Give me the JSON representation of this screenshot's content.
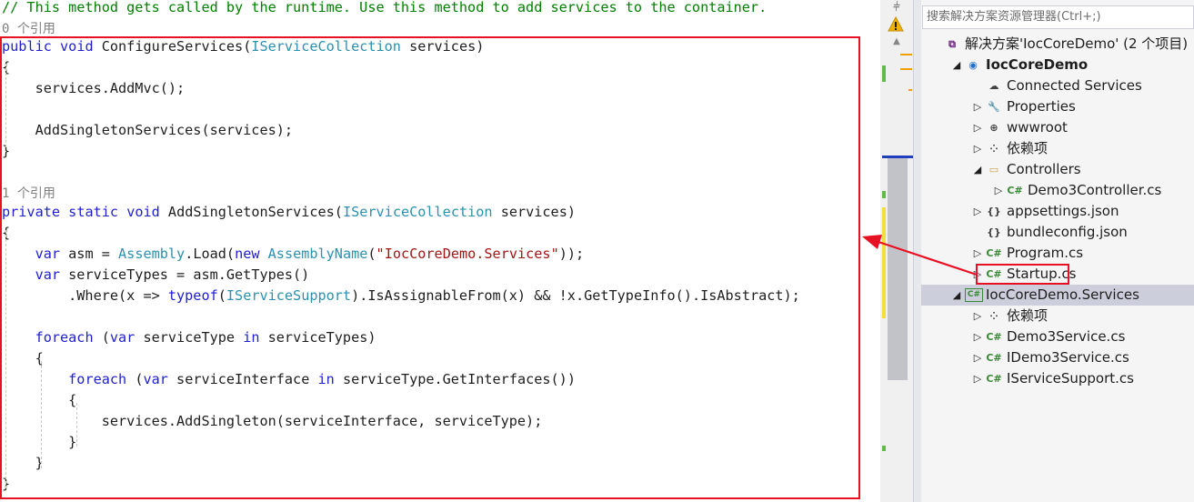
{
  "editor": {
    "lines": [
      [
        {
          "t": "cmt",
          "s": "// This method gets called by the runtime. Use this method to add services to the container."
        }
      ],
      [
        {
          "t": "ref",
          "s": "0 个引用"
        }
      ],
      [
        {
          "t": "kw",
          "s": "public"
        },
        {
          "t": "plain",
          "s": " "
        },
        {
          "t": "kw",
          "s": "void"
        },
        {
          "t": "plain",
          "s": " ConfigureServices("
        },
        {
          "t": "type",
          "s": "IServiceCollection"
        },
        {
          "t": "plain",
          "s": " services)"
        }
      ],
      [
        {
          "t": "plain",
          "s": "{"
        }
      ],
      [
        {
          "t": "plain",
          "s": "    services.AddMvc();"
        }
      ],
      [
        {
          "t": "plain",
          "s": ""
        }
      ],
      [
        {
          "t": "plain",
          "s": "    AddSingletonServices(services);"
        }
      ],
      [
        {
          "t": "plain",
          "s": "}"
        }
      ],
      [
        {
          "t": "plain",
          "s": ""
        }
      ],
      [
        {
          "t": "ref",
          "s": "1 个引用"
        }
      ],
      [
        {
          "t": "kw",
          "s": "private"
        },
        {
          "t": "plain",
          "s": " "
        },
        {
          "t": "kw",
          "s": "static"
        },
        {
          "t": "plain",
          "s": " "
        },
        {
          "t": "kw",
          "s": "void"
        },
        {
          "t": "plain",
          "s": " AddSingletonServices("
        },
        {
          "t": "type",
          "s": "IServiceCollection"
        },
        {
          "t": "plain",
          "s": " services)"
        }
      ],
      [
        {
          "t": "plain",
          "s": "{"
        }
      ],
      [
        {
          "t": "plain",
          "s": "    "
        },
        {
          "t": "kw",
          "s": "var"
        },
        {
          "t": "plain",
          "s": " asm = "
        },
        {
          "t": "type",
          "s": "Assembly"
        },
        {
          "t": "plain",
          "s": ".Load("
        },
        {
          "t": "kw",
          "s": "new"
        },
        {
          "t": "plain",
          "s": " "
        },
        {
          "t": "type",
          "s": "AssemblyName"
        },
        {
          "t": "plain",
          "s": "("
        },
        {
          "t": "str",
          "s": "\"IocCoreDemo.Services\""
        },
        {
          "t": "plain",
          "s": "));"
        }
      ],
      [
        {
          "t": "plain",
          "s": "    "
        },
        {
          "t": "kw",
          "s": "var"
        },
        {
          "t": "plain",
          "s": " serviceTypes = asm.GetTypes()"
        }
      ],
      [
        {
          "t": "plain",
          "s": "        .Where(x => "
        },
        {
          "t": "kw",
          "s": "typeof"
        },
        {
          "t": "plain",
          "s": "("
        },
        {
          "t": "type",
          "s": "IServiceSupport"
        },
        {
          "t": "plain",
          "s": ").IsAssignableFrom(x) && !x.GetTypeInfo().IsAbstract);"
        }
      ],
      [
        {
          "t": "plain",
          "s": ""
        }
      ],
      [
        {
          "t": "plain",
          "s": "    "
        },
        {
          "t": "kw",
          "s": "foreach"
        },
        {
          "t": "plain",
          "s": " ("
        },
        {
          "t": "kw",
          "s": "var"
        },
        {
          "t": "plain",
          "s": " serviceType "
        },
        {
          "t": "kw",
          "s": "in"
        },
        {
          "t": "plain",
          "s": " serviceTypes)"
        }
      ],
      [
        {
          "t": "plain",
          "s": "    {"
        }
      ],
      [
        {
          "t": "plain",
          "s": "        "
        },
        {
          "t": "kw",
          "s": "foreach"
        },
        {
          "t": "plain",
          "s": " ("
        },
        {
          "t": "kw",
          "s": "var"
        },
        {
          "t": "plain",
          "s": " serviceInterface "
        },
        {
          "t": "kw",
          "s": "in"
        },
        {
          "t": "plain",
          "s": " serviceType.GetInterfaces())"
        }
      ],
      [
        {
          "t": "plain",
          "s": "        {"
        }
      ],
      [
        {
          "t": "plain",
          "s": "            services.AddSingleton(serviceInterface, serviceType);"
        }
      ],
      [
        {
          "t": "plain",
          "s": "        }"
        }
      ],
      [
        {
          "t": "plain",
          "s": "    }"
        }
      ],
      [
        {
          "t": "plain",
          "s": "}"
        }
      ]
    ]
  },
  "colors": {
    "keyword": "#1f1fcf",
    "type": "#2b91af",
    "string": "#a31515",
    "comment": "#008000",
    "highlight": "#e81123",
    "cs_icon": "#388a34",
    "selected_row": "#cccedb"
  },
  "scrollbar": {
    "split_icon": "split-icon",
    "warning_icon": "warning-icon"
  },
  "solution_explorer": {
    "search_placeholder": "搜索解决方案资源管理器(Ctrl+;)",
    "items": [
      {
        "label": "解决方案'IocCoreDemo' (2 个项目)",
        "icon": "solution-icon",
        "expander": "",
        "bold": false,
        "selected": false
      },
      {
        "label": "IocCoreDemo",
        "icon": "web-project-icon",
        "expander": "expanded",
        "bold": true,
        "selected": false
      },
      {
        "label": "Connected Services",
        "icon": "cloud-icon",
        "expander": "",
        "bold": false,
        "selected": false
      },
      {
        "label": "Properties",
        "icon": "wrench-icon",
        "expander": "collapsed",
        "bold": false,
        "selected": false
      },
      {
        "label": "wwwroot",
        "icon": "globe-icon",
        "expander": "collapsed",
        "bold": false,
        "selected": false
      },
      {
        "label": "依赖项",
        "icon": "dependencies-icon",
        "expander": "collapsed",
        "bold": false,
        "selected": false
      },
      {
        "label": "Controllers",
        "icon": "folder-icon",
        "expander": "expanded",
        "bold": false,
        "selected": false
      },
      {
        "label": "Demo3Controller.cs",
        "icon": "csharp-file-icon",
        "expander": "collapsed",
        "bold": false,
        "selected": false
      },
      {
        "label": "appsettings.json",
        "icon": "json-file-icon",
        "expander": "collapsed",
        "bold": false,
        "selected": false
      },
      {
        "label": "bundleconfig.json",
        "icon": "json-file-icon",
        "expander": "",
        "bold": false,
        "selected": false
      },
      {
        "label": "Program.cs",
        "icon": "csharp-file-icon",
        "expander": "collapsed",
        "bold": false,
        "selected": false
      },
      {
        "label": "Startup.cs",
        "icon": "csharp-file-icon",
        "expander": "collapsed",
        "bold": false,
        "selected": false
      },
      {
        "label": "IocCoreDemo.Services",
        "icon": "csharp-project-icon",
        "expander": "expanded",
        "bold": false,
        "selected": true
      },
      {
        "label": "依赖项",
        "icon": "dependencies-icon",
        "expander": "collapsed",
        "bold": false,
        "selected": false
      },
      {
        "label": "Demo3Service.cs",
        "icon": "csharp-file-icon",
        "expander": "collapsed",
        "bold": false,
        "selected": false
      },
      {
        "label": "IDemo3Service.cs",
        "icon": "csharp-file-icon",
        "expander": "collapsed",
        "bold": false,
        "selected": false
      },
      {
        "label": "IServiceSupport.cs",
        "icon": "csharp-file-icon",
        "expander": "collapsed",
        "bold": false,
        "selected": false
      }
    ]
  }
}
